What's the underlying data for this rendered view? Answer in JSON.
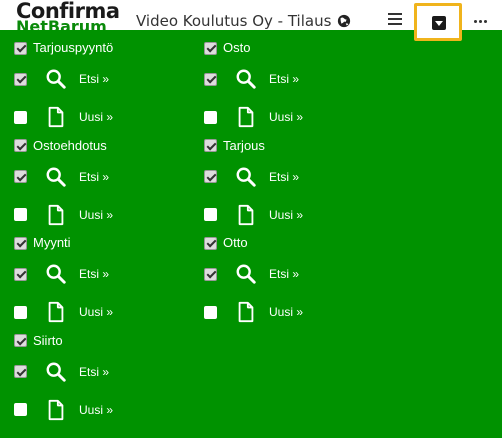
{
  "header": {
    "logo": "Confirma",
    "logo_sub": "NetBarum",
    "title": "Video Koulutus Oy - Tilaus",
    "globe_icon": "globe-icon",
    "menu_icon": "hamburger-icon",
    "dropdown_icon": "caret-down-square-icon",
    "more_icon": "more-horizontal-icon",
    "highlight_color": "#f0b41c"
  },
  "panel": {
    "background": "#009200",
    "left_column": [
      {
        "label": "Tarjouspyyntö",
        "checked": true,
        "search": {
          "label": "Etsi »",
          "checked": true
        },
        "new": {
          "label": "Uusi »",
          "checked": false
        }
      },
      {
        "label": "Ostoehdotus",
        "checked": true,
        "search": {
          "label": "Etsi »",
          "checked": true
        },
        "new": {
          "label": "Uusi »",
          "checked": false
        }
      },
      {
        "label": "Myynti",
        "checked": true,
        "search": {
          "label": "Etsi »",
          "checked": true
        },
        "new": {
          "label": "Uusi »",
          "checked": false
        }
      },
      {
        "label": "Siirto",
        "checked": true,
        "search": {
          "label": "Etsi »",
          "checked": true
        },
        "new": {
          "label": "Uusi »",
          "checked": false
        }
      }
    ],
    "right_column": [
      {
        "label": "Osto",
        "checked": true,
        "search": {
          "label": "Etsi »",
          "checked": true
        },
        "new": {
          "label": "Uusi »",
          "checked": false
        }
      },
      {
        "label": "Tarjous",
        "checked": true,
        "search": {
          "label": "Etsi »",
          "checked": true
        },
        "new": {
          "label": "Uusi »",
          "checked": false
        }
      },
      {
        "label": "Otto",
        "checked": true,
        "search": {
          "label": "Etsi »",
          "checked": true
        },
        "new": {
          "label": "Uusi »",
          "checked": false
        }
      }
    ]
  }
}
